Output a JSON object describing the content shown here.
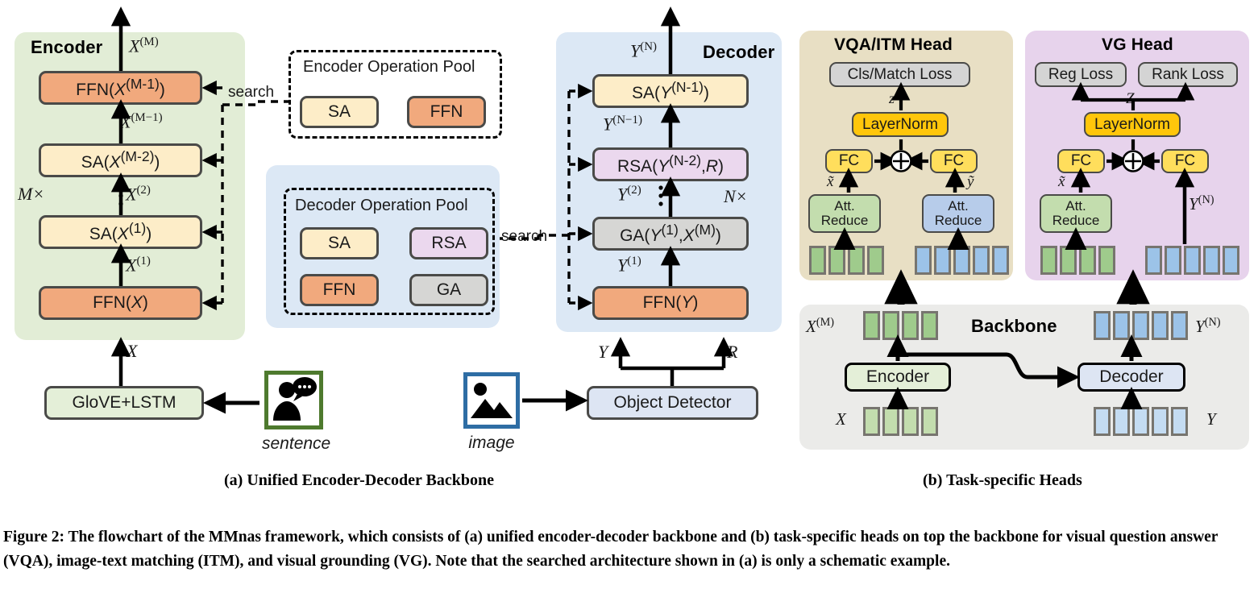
{
  "figure": {
    "caption": "Figure 2: The flowchart of the MMnas framework, which consists of (a) unified encoder-decoder backbone and (b) task-specific heads on top the backbone for visual question answer (VQA), image-text matching (ITM), and visual grounding (VG). Note that the searched architecture shown in (a) is only a schematic example.",
    "subcaption_a": "(a) Unified Encoder-Decoder Backbone",
    "subcaption_b": "(b) Task-specific Heads"
  },
  "colors": {
    "ffn": "#F1A97D",
    "sa": "#FDEDC8",
    "rsa": "#EBD8EE",
    "ga": "#D6D6D4",
    "loss": "#D4D4D4",
    "layernorm": "#FFC60B",
    "fc": "#FFDE5C",
    "att_reduce_green": "#C3DDAE",
    "att_reduce_blue": "#B7CCEA",
    "token_green": "#9FCB8C",
    "token_blue": "#9CC3E8",
    "encoder_panel": "#E2EDD6",
    "decoder_panel": "#DCE8F5",
    "vqa_panel": "#E8DFC4",
    "vg_panel": "#E7D3EC",
    "backbone_panel": "#EBEBE9",
    "glove_box": "#E4EFD8",
    "object_detector_box": "#DDE5F3",
    "sentence_frame": "#4E7A2E",
    "image_frame": "#2E6DA4",
    "outline": "#4A4A48"
  },
  "encoder": {
    "panel_label": "Encoder",
    "repeat_label": "M×",
    "blocks": [
      {
        "label_html": "FFN(X<sup>(M-1)</sup>)",
        "kind": "ffn"
      },
      {
        "label_html": "SA(X<sup>(M-2)</sup>)",
        "kind": "sa"
      },
      {
        "label_html": "SA(X<sup>(1)</sup>)",
        "kind": "sa"
      },
      {
        "label_html": "FFN(X)",
        "kind": "ffn"
      }
    ],
    "edge_labels": [
      {
        "text_html": "X<sup>(M)</sup>"
      },
      {
        "text_html": "X<sup>(M−1)</sup>"
      },
      {
        "text_html": "X<sup>(2)</sup>"
      },
      {
        "text_html": "X<sup>(1)</sup>"
      },
      {
        "text_html": "X"
      }
    ],
    "search_label": "search"
  },
  "encoder_pool": {
    "title": "Encoder Operation Pool",
    "ops": [
      {
        "label": "SA",
        "kind": "sa"
      },
      {
        "label": "FFN",
        "kind": "ffn"
      }
    ]
  },
  "decoder_pool": {
    "title": "Decoder Operation Pool",
    "ops": [
      {
        "label": "SA",
        "kind": "sa"
      },
      {
        "label": "RSA",
        "kind": "rsa"
      },
      {
        "label": "FFN",
        "kind": "ffn"
      },
      {
        "label": "GA",
        "kind": "ga"
      }
    ],
    "search_label": "search"
  },
  "decoder": {
    "panel_label": "Decoder",
    "repeat_label": "N×",
    "blocks": [
      {
        "label_html": "SA(Y<sup>(N-1)</sup>)",
        "kind": "sa"
      },
      {
        "label_html": "RSA(Y<sup>(N-2)</sup>,R)",
        "kind": "rsa"
      },
      {
        "label_html": "GA(Y<sup>(1)</sup>,X<sup>(M)</sup>)",
        "kind": "ga"
      },
      {
        "label_html": "FFN(Y)",
        "kind": "ffn"
      }
    ],
    "edge_labels": [
      {
        "text_html": "Y<sup>(N)</sup>"
      },
      {
        "text_html": "Y<sup>(N−1)</sup>"
      },
      {
        "text_html": "Y<sup>(2)</sup>"
      },
      {
        "text_html": "Y<sup>(1)</sup>"
      },
      {
        "text_html": "Y"
      },
      {
        "text_html": "R"
      }
    ]
  },
  "inputs": {
    "text_encoder": "GloVE+LSTM",
    "sentence_caption": "sentence",
    "sentence_icon": "person-speech-bubble-icon",
    "image_caption": "image",
    "image_icon": "picture-mountain-icon",
    "object_detector": "Object Detector"
  },
  "vqa_head": {
    "title": "VQA/ITM Head",
    "loss": "Cls/Match Loss",
    "layernorm": "LayerNorm",
    "fc_left": "FC",
    "fc_right": "FC",
    "att_reduce_left": "Att.\nReduce",
    "att_reduce_left_line1": "Att.",
    "att_reduce_left_line2": "Reduce",
    "att_reduce_right_line1": "Att.",
    "att_reduce_right_line2": "Reduce",
    "sum_symbol": "⊕",
    "z_label": "z",
    "x_tilde_label": "x̃",
    "y_tilde_label": "ỹ",
    "token_count_left": 4,
    "token_count_right": 5
  },
  "vg_head": {
    "title": "VG Head",
    "loss_left": "Reg Loss",
    "loss_right": "Rank Loss",
    "layernorm": "LayerNorm",
    "fc_left": "FC",
    "fc_right": "FC",
    "att_reduce_line1": "Att.",
    "att_reduce_line2": "Reduce",
    "sum_symbol": "⊕",
    "z_label": "Z",
    "x_tilde_label": "x̃",
    "y_n_label_html": "Y<sup>(N)</sup>",
    "token_count_left": 4,
    "token_count_right": 5
  },
  "backbone": {
    "title": "Backbone",
    "encoder": "Encoder",
    "decoder": "Decoder",
    "label_x": "X",
    "label_xm_html": "X<sup>(M)</sup>",
    "label_y": "Y",
    "label_yn_html": "Y<sup>(N)</sup>",
    "token_count_x": 4,
    "token_count_xm": 4,
    "token_count_y": 5,
    "token_count_yn": 5
  }
}
